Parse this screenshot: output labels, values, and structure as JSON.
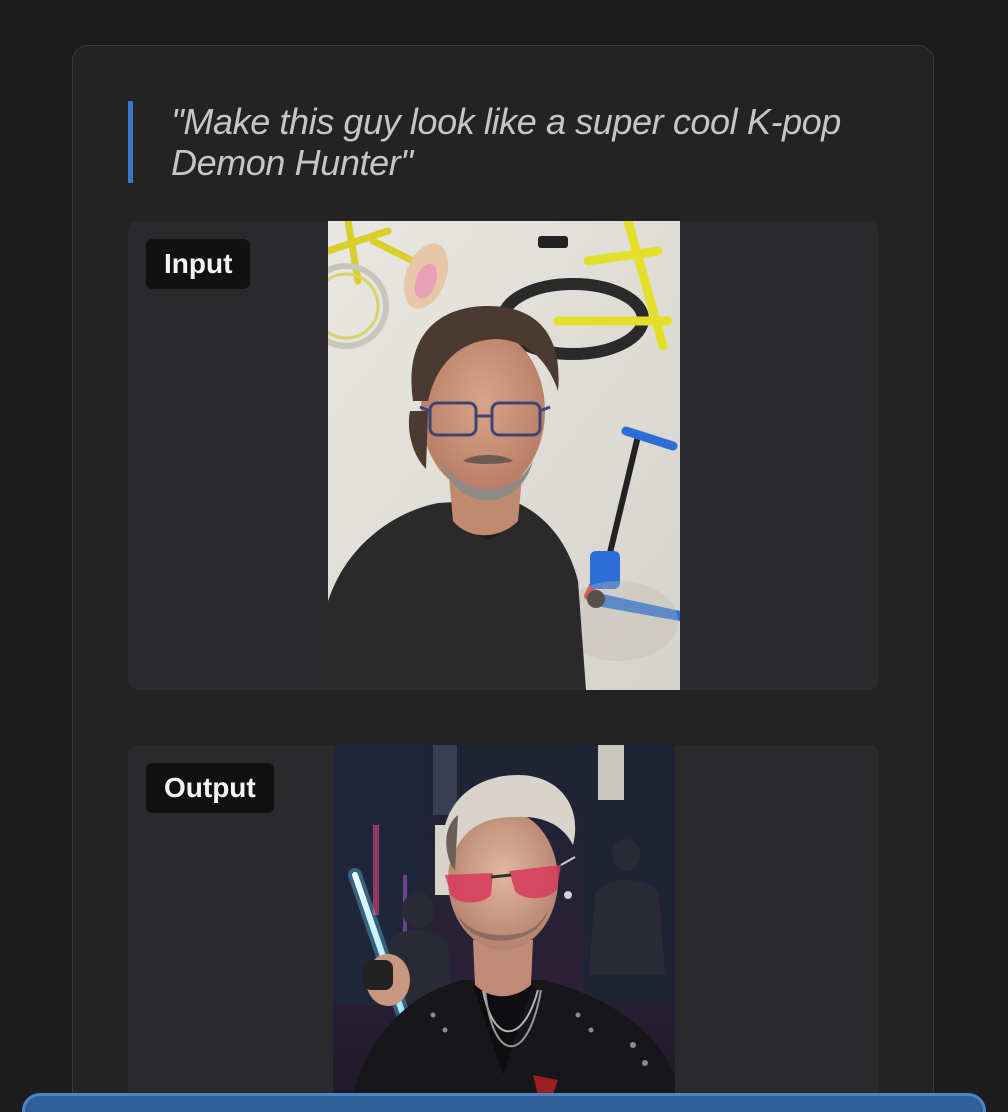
{
  "prompt": {
    "text": "\"Make this guy look like a super cool K-pop Demon Hunter\""
  },
  "input": {
    "label": "Input"
  },
  "output": {
    "label": "Output"
  },
  "colors": {
    "accent": "#3a78c2",
    "background": "#1c1c1d",
    "card": "#232324",
    "panel": "#2a2a2c",
    "bottom_bar": "#2e5f96"
  }
}
